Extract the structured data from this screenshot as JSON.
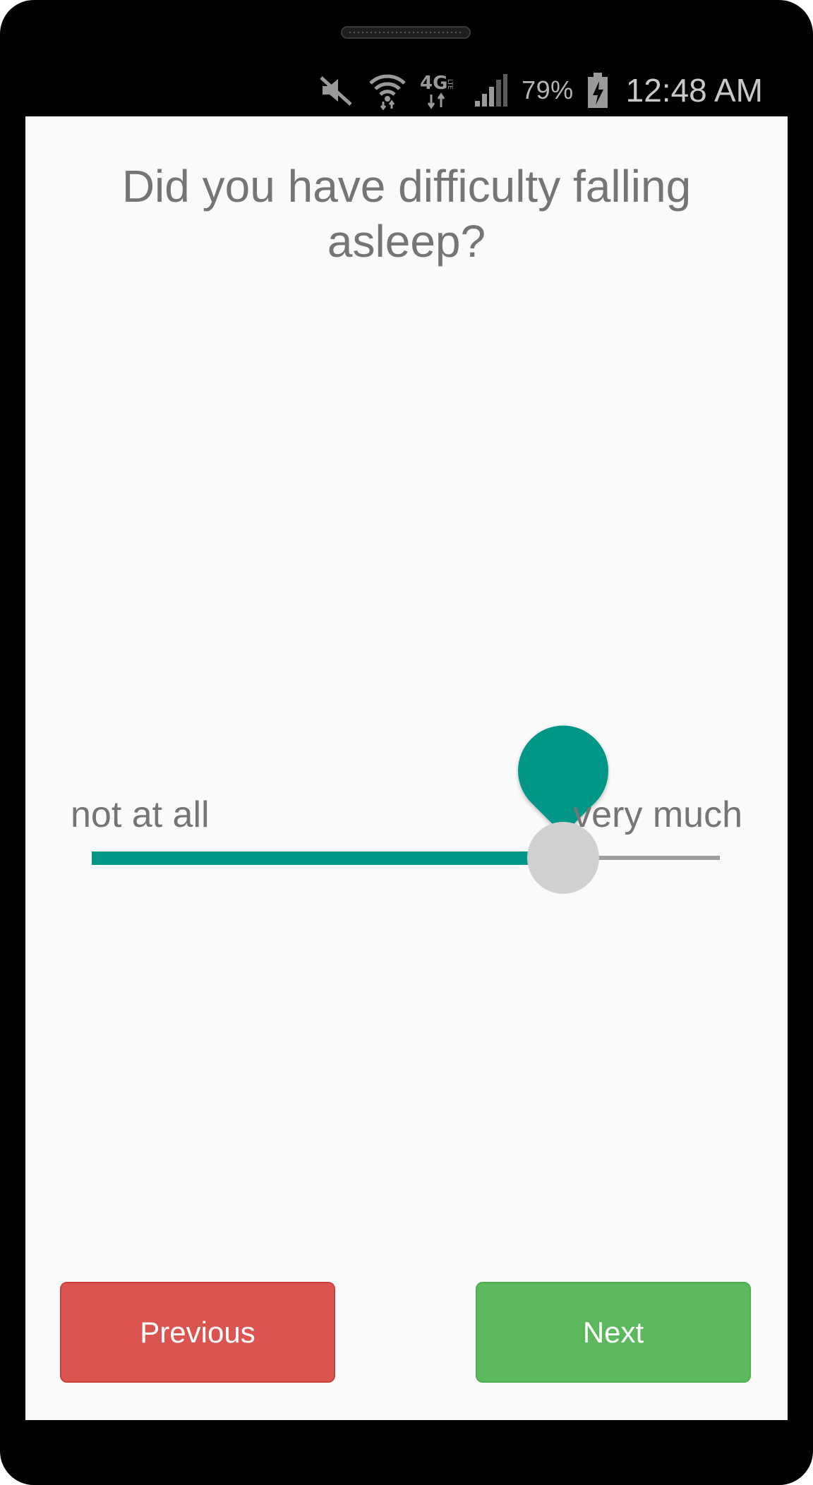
{
  "status_bar": {
    "icons": [
      "mute-icon",
      "wifi-icon",
      "4g-lte-icon",
      "signal-icon",
      "battery-charging-icon"
    ],
    "battery_percent": "79%",
    "time": "12:48 AM"
  },
  "question": {
    "text": "Did you have difficulty falling asleep?"
  },
  "slider": {
    "value_fraction": 0.75,
    "min_label": "not at all",
    "max_label": "very much",
    "accent_color": "#009688",
    "track_color": "#9e9e9e",
    "thumb_color": "#d0d0d0"
  },
  "buttons": {
    "previous_label": "Previous",
    "next_label": "Next",
    "previous_color": "#db544f",
    "next_color": "#5cb85c"
  }
}
